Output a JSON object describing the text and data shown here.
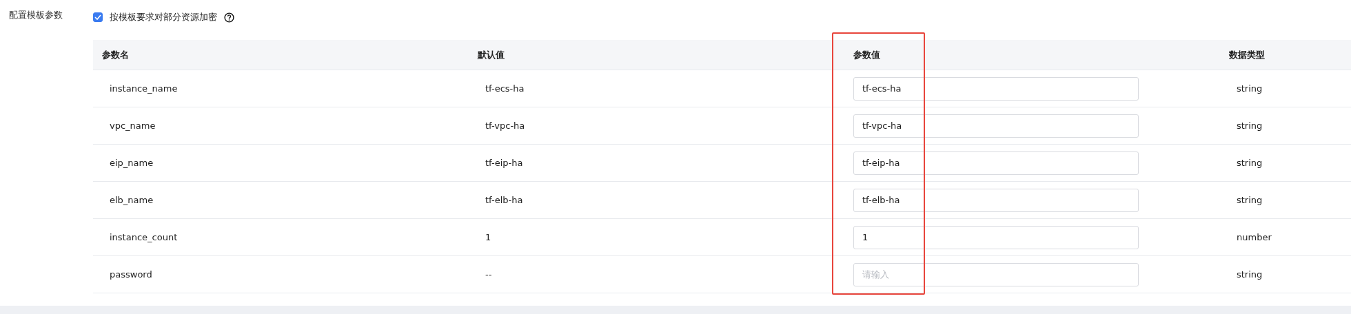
{
  "section_label": "配置模板参数",
  "encrypt_option": {
    "label": "按模板要求对部分资源加密",
    "checked": true
  },
  "table": {
    "columns": [
      {
        "title": "参数名",
        "highlighted": false
      },
      {
        "title": "默认值",
        "highlighted": false
      },
      {
        "title": "参数值",
        "highlighted": true
      },
      {
        "title": "数据类型",
        "highlighted": false
      }
    ],
    "rows": [
      {
        "name": "instance_name",
        "default": "tf-ecs-ha",
        "value": "tf-ecs-ha",
        "type": "string"
      },
      {
        "name": "vpc_name",
        "default": "tf-vpc-ha",
        "value": "tf-vpc-ha",
        "type": "string"
      },
      {
        "name": "eip_name",
        "default": "tf-eip-ha",
        "value": "tf-eip-ha",
        "type": "string"
      },
      {
        "name": "elb_name",
        "default": "tf-elb-ha",
        "value": "tf-elb-ha",
        "type": "string"
      },
      {
        "name": "instance_count",
        "default": "1",
        "value": "1",
        "type": "number"
      },
      {
        "name": "password",
        "default": "--",
        "placeholder": "请输入",
        "type": "string"
      }
    ]
  }
}
